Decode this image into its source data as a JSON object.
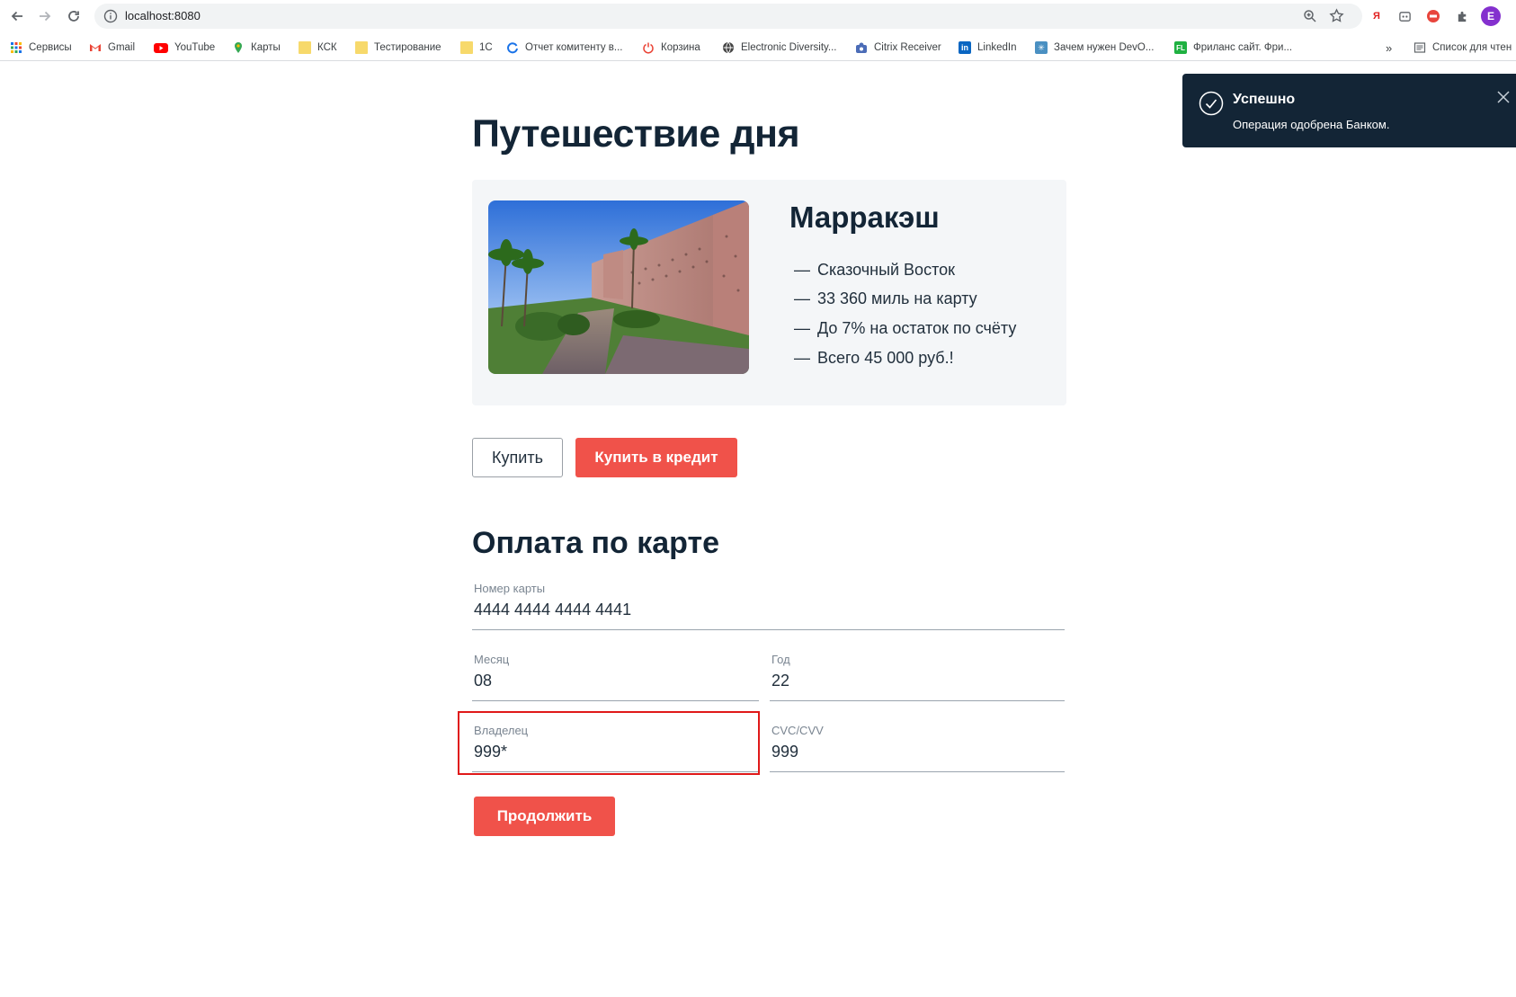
{
  "browser": {
    "url": "localhost:8080",
    "profile_initial": "E",
    "bookmarks": [
      {
        "label": "Сервисы",
        "icon": "apps-grid-icon"
      },
      {
        "label": "Gmail",
        "icon": "gmail-icon"
      },
      {
        "label": "YouTube",
        "icon": "youtube-icon"
      },
      {
        "label": "Карты",
        "icon": "maps-pin-icon"
      },
      {
        "label": "КСК",
        "icon": "folder-icon"
      },
      {
        "label": "Тестирование",
        "icon": "folder-icon"
      },
      {
        "label": "1С",
        "icon": "folder-icon"
      },
      {
        "label": "Отчет комитенту в...",
        "icon": "refresh-c-icon"
      },
      {
        "label": "Корзина",
        "icon": "power-icon"
      },
      {
        "label": "Electronic Diversity...",
        "icon": "globe-icon"
      },
      {
        "label": "Citrix Receiver",
        "icon": "citrix-icon"
      },
      {
        "label": "LinkedIn",
        "icon": "linkedin-icon"
      },
      {
        "label": "Зачем нужен DevO...",
        "icon": "sparkle-icon"
      },
      {
        "label": "Фриланс сайт. Фри...",
        "icon": "fl-icon"
      }
    ],
    "overflow": "»",
    "reading_list": "Список для чтен"
  },
  "page": {
    "title": "Путешествие дня",
    "tour": {
      "city": "Марракэш",
      "dash": "—",
      "features": [
        "Сказочный Восток",
        "33 360 миль на карту",
        "До 7% на остаток по счёту",
        "Всего 45 000 руб.!"
      ]
    },
    "buy_label": "Купить",
    "buy_credit_label": "Купить в кредит",
    "payment": {
      "title": "Оплата по карте",
      "card_number": {
        "label": "Номер карты",
        "value": "4444 4444 4444 4441"
      },
      "month": {
        "label": "Месяц",
        "value": "08"
      },
      "year": {
        "label": "Год",
        "value": "22"
      },
      "owner": {
        "label": "Владелец",
        "value": "999*"
      },
      "cvc": {
        "label": "CVC/CVV",
        "value": "999"
      },
      "continue_label": "Продолжить"
    }
  },
  "notification": {
    "title": "Успешно",
    "message": "Операция одобрена Банком.",
    "status_color": "#132536"
  },
  "colors": {
    "accent_red": "#f0524a",
    "highlight_border": "#e01919",
    "heading": "#132536"
  }
}
